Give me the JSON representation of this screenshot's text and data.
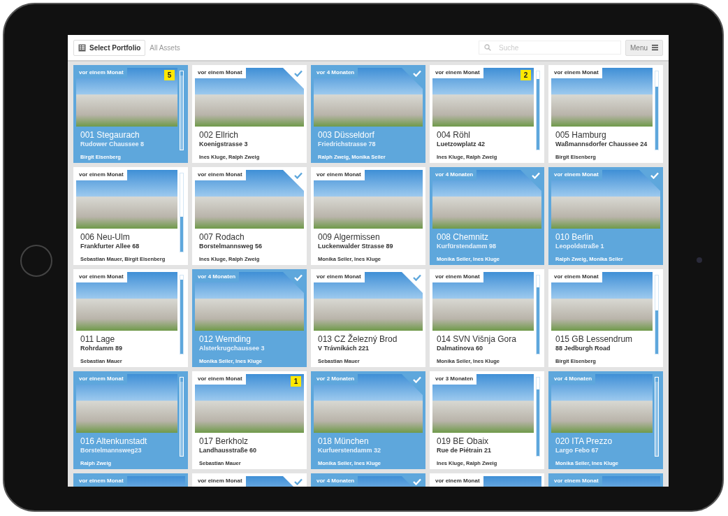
{
  "top_bar": {
    "portfolio_button": "Select Portfolio",
    "breadcrumb": "All Assets",
    "search": {
      "placeholder": "Suche"
    },
    "menu_button": "Menu"
  },
  "tiles": [
    {
      "age": "vor einem Monat",
      "title": "001 Stegaurach",
      "address": "Rudower Chaussee 8",
      "people": "Birgit Eisenberg",
      "selected": true,
      "checked": false,
      "badge": "5",
      "level": 0.95
    },
    {
      "age": "vor einem Monat",
      "title": "002 Ellrich",
      "address": "Koenigstrasse 3",
      "people": "Ines Kluge, Ralph Zweig",
      "selected": false,
      "checked": true
    },
    {
      "age": "vor 4 Monaten",
      "title": "003 Düsseldorf",
      "address": "Friedrichstrasse 78",
      "people": "Ralph Zweig, Monika Seiler",
      "selected": true,
      "checked": true
    },
    {
      "age": "vor einem Monat",
      "title": "004 Röhl",
      "address": "Luetzowplatz 42",
      "people": "Ines Kluge, Ralph Zweig",
      "selected": false,
      "checked": false,
      "badge": "2",
      "level": 0.9
    },
    {
      "age": "vor einem Monat",
      "title": "005 Hamburg",
      "address": "Waßmannsdorfer Chaussee 24",
      "people": "Birgit Eisenberg",
      "selected": false,
      "checked": false,
      "level": 0.8
    },
    {
      "age": "vor einem Monat",
      "title": "006 Neu-Ulm",
      "address": "Frankfurter Allee 68",
      "people": "Sebastian Mauer, Birgit Eisenberg",
      "selected": false,
      "checked": false,
      "level": 0.45
    },
    {
      "age": "vor einem Monat",
      "title": "007 Rodach",
      "address": "Borstelmannsweg 56",
      "people": "Ines Kluge, Ralph Zweig",
      "selected": false,
      "checked": true
    },
    {
      "age": "vor einem Monat",
      "title": "009 Algermissen",
      "address": "Luckenwalder Strasse 89",
      "people": "Monika Seiler, Ines Kluge",
      "selected": false,
      "checked": false
    },
    {
      "age": "vor 4 Monaten",
      "title": "008 Chemnitz",
      "address": "Kurfürstendamm 98",
      "people": "Monika Seiler, Ines Kluge",
      "selected": true,
      "checked": true
    },
    {
      "age": "vor einem Monat",
      "title": "010 Berlin",
      "address": "Leopoldstraße 1",
      "people": "Ralph Zweig, Monika Seiler",
      "selected": true,
      "checked": true
    },
    {
      "age": "vor einem Monat",
      "title": "011 Lage",
      "address": "Rohrdamm 89",
      "people": "Sebastian Mauer",
      "selected": false,
      "checked": false,
      "level": 0.95
    },
    {
      "age": "vor 4 Monaten",
      "title": "012 Wemding",
      "address": "Alsterkrugchaussee 3",
      "people": "Monika Seiler, Ines Kluge",
      "selected": true,
      "checked": true
    },
    {
      "age": "vor einem Monat",
      "title": "013 CZ Železný Brod",
      "address": "V Trávníkách 221",
      "people": "Sebastian Mauer",
      "selected": false,
      "checked": true
    },
    {
      "age": "vor einem Monat",
      "title": "014 SVN Višnja Gora",
      "address": "Dalmatinova 60",
      "people": "Monika Seiler, Ines Kluge",
      "selected": false,
      "checked": false,
      "level": 0.85
    },
    {
      "age": "vor einem Monat",
      "title": "015 GB Lessendrum",
      "address": "88 Jedburgh Road",
      "people": "Birgit Eisenberg",
      "selected": false,
      "checked": false,
      "level": 0.55
    },
    {
      "age": "vor einem Monat",
      "title": "016 Altenkunstadt",
      "address": "Borstelmannsweg23",
      "people": "Ralph Zweig",
      "selected": true,
      "checked": false,
      "level": 0.95
    },
    {
      "age": "vor einem Monat",
      "title": "017 Berkholz",
      "address": "Landhausstraße 60",
      "people": "Sebastian Mauer",
      "selected": false,
      "checked": false,
      "badge": "1"
    },
    {
      "age": "vor 2 Monaten",
      "title": "018 München",
      "address": "Kurfuerstendamm 32",
      "people": "Monika Seiler, Ines Kluge",
      "selected": true,
      "checked": true
    },
    {
      "age": "vor 3 Monaten",
      "title": "019 BE Obaix",
      "address": "Rue de Piétrain 21",
      "people": "Ines Kluge, Ralph Zweig",
      "selected": false,
      "checked": false,
      "level": 0.85
    },
    {
      "age": "vor 4 Monaten",
      "title": "020 ITA Prezzo",
      "address": "Largo Febo 67",
      "people": "Monika Seiler, Ines Kluge",
      "selected": true,
      "checked": false,
      "level": 0.95
    },
    {
      "age": "vor einem Monat",
      "selected": true,
      "checked": false
    },
    {
      "age": "vor einem Monat",
      "selected": false,
      "checked": true
    },
    {
      "age": "vor 4 Monaten",
      "selected": true,
      "checked": true
    },
    {
      "age": "vor einem Monat",
      "selected": false,
      "checked": false
    },
    {
      "age": "vor einem Monat",
      "selected": true,
      "checked": false
    }
  ]
}
